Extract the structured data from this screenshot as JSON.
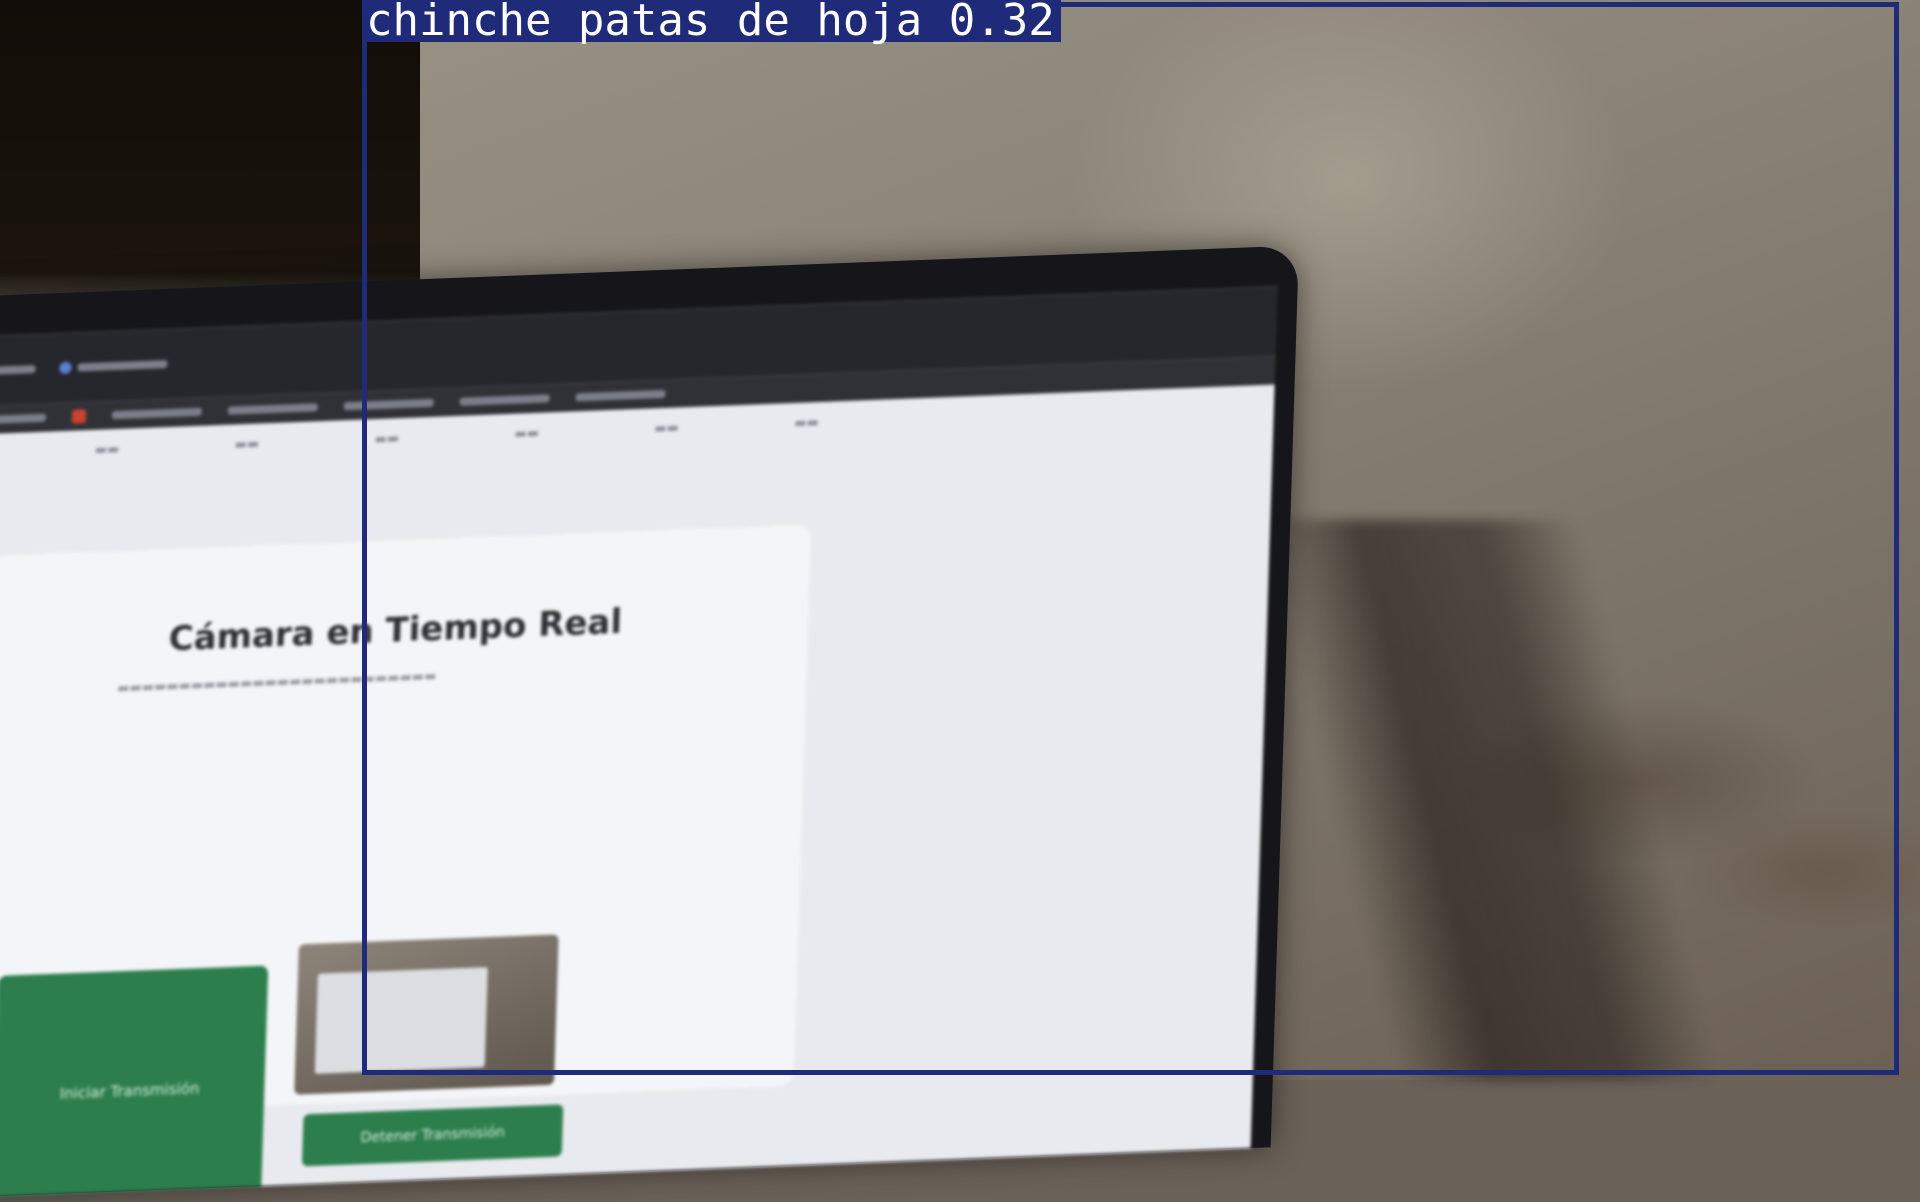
{
  "detection": {
    "label": "chinche patas de hoja 0.32",
    "box_color": "#1f2a78",
    "text_color": "#ffffff"
  },
  "screen": {
    "card_title": "Cámara en Tiempo Real",
    "start_button_label": "Iniciar Transmisión",
    "capture_button_label": "Detener Transmisión"
  }
}
